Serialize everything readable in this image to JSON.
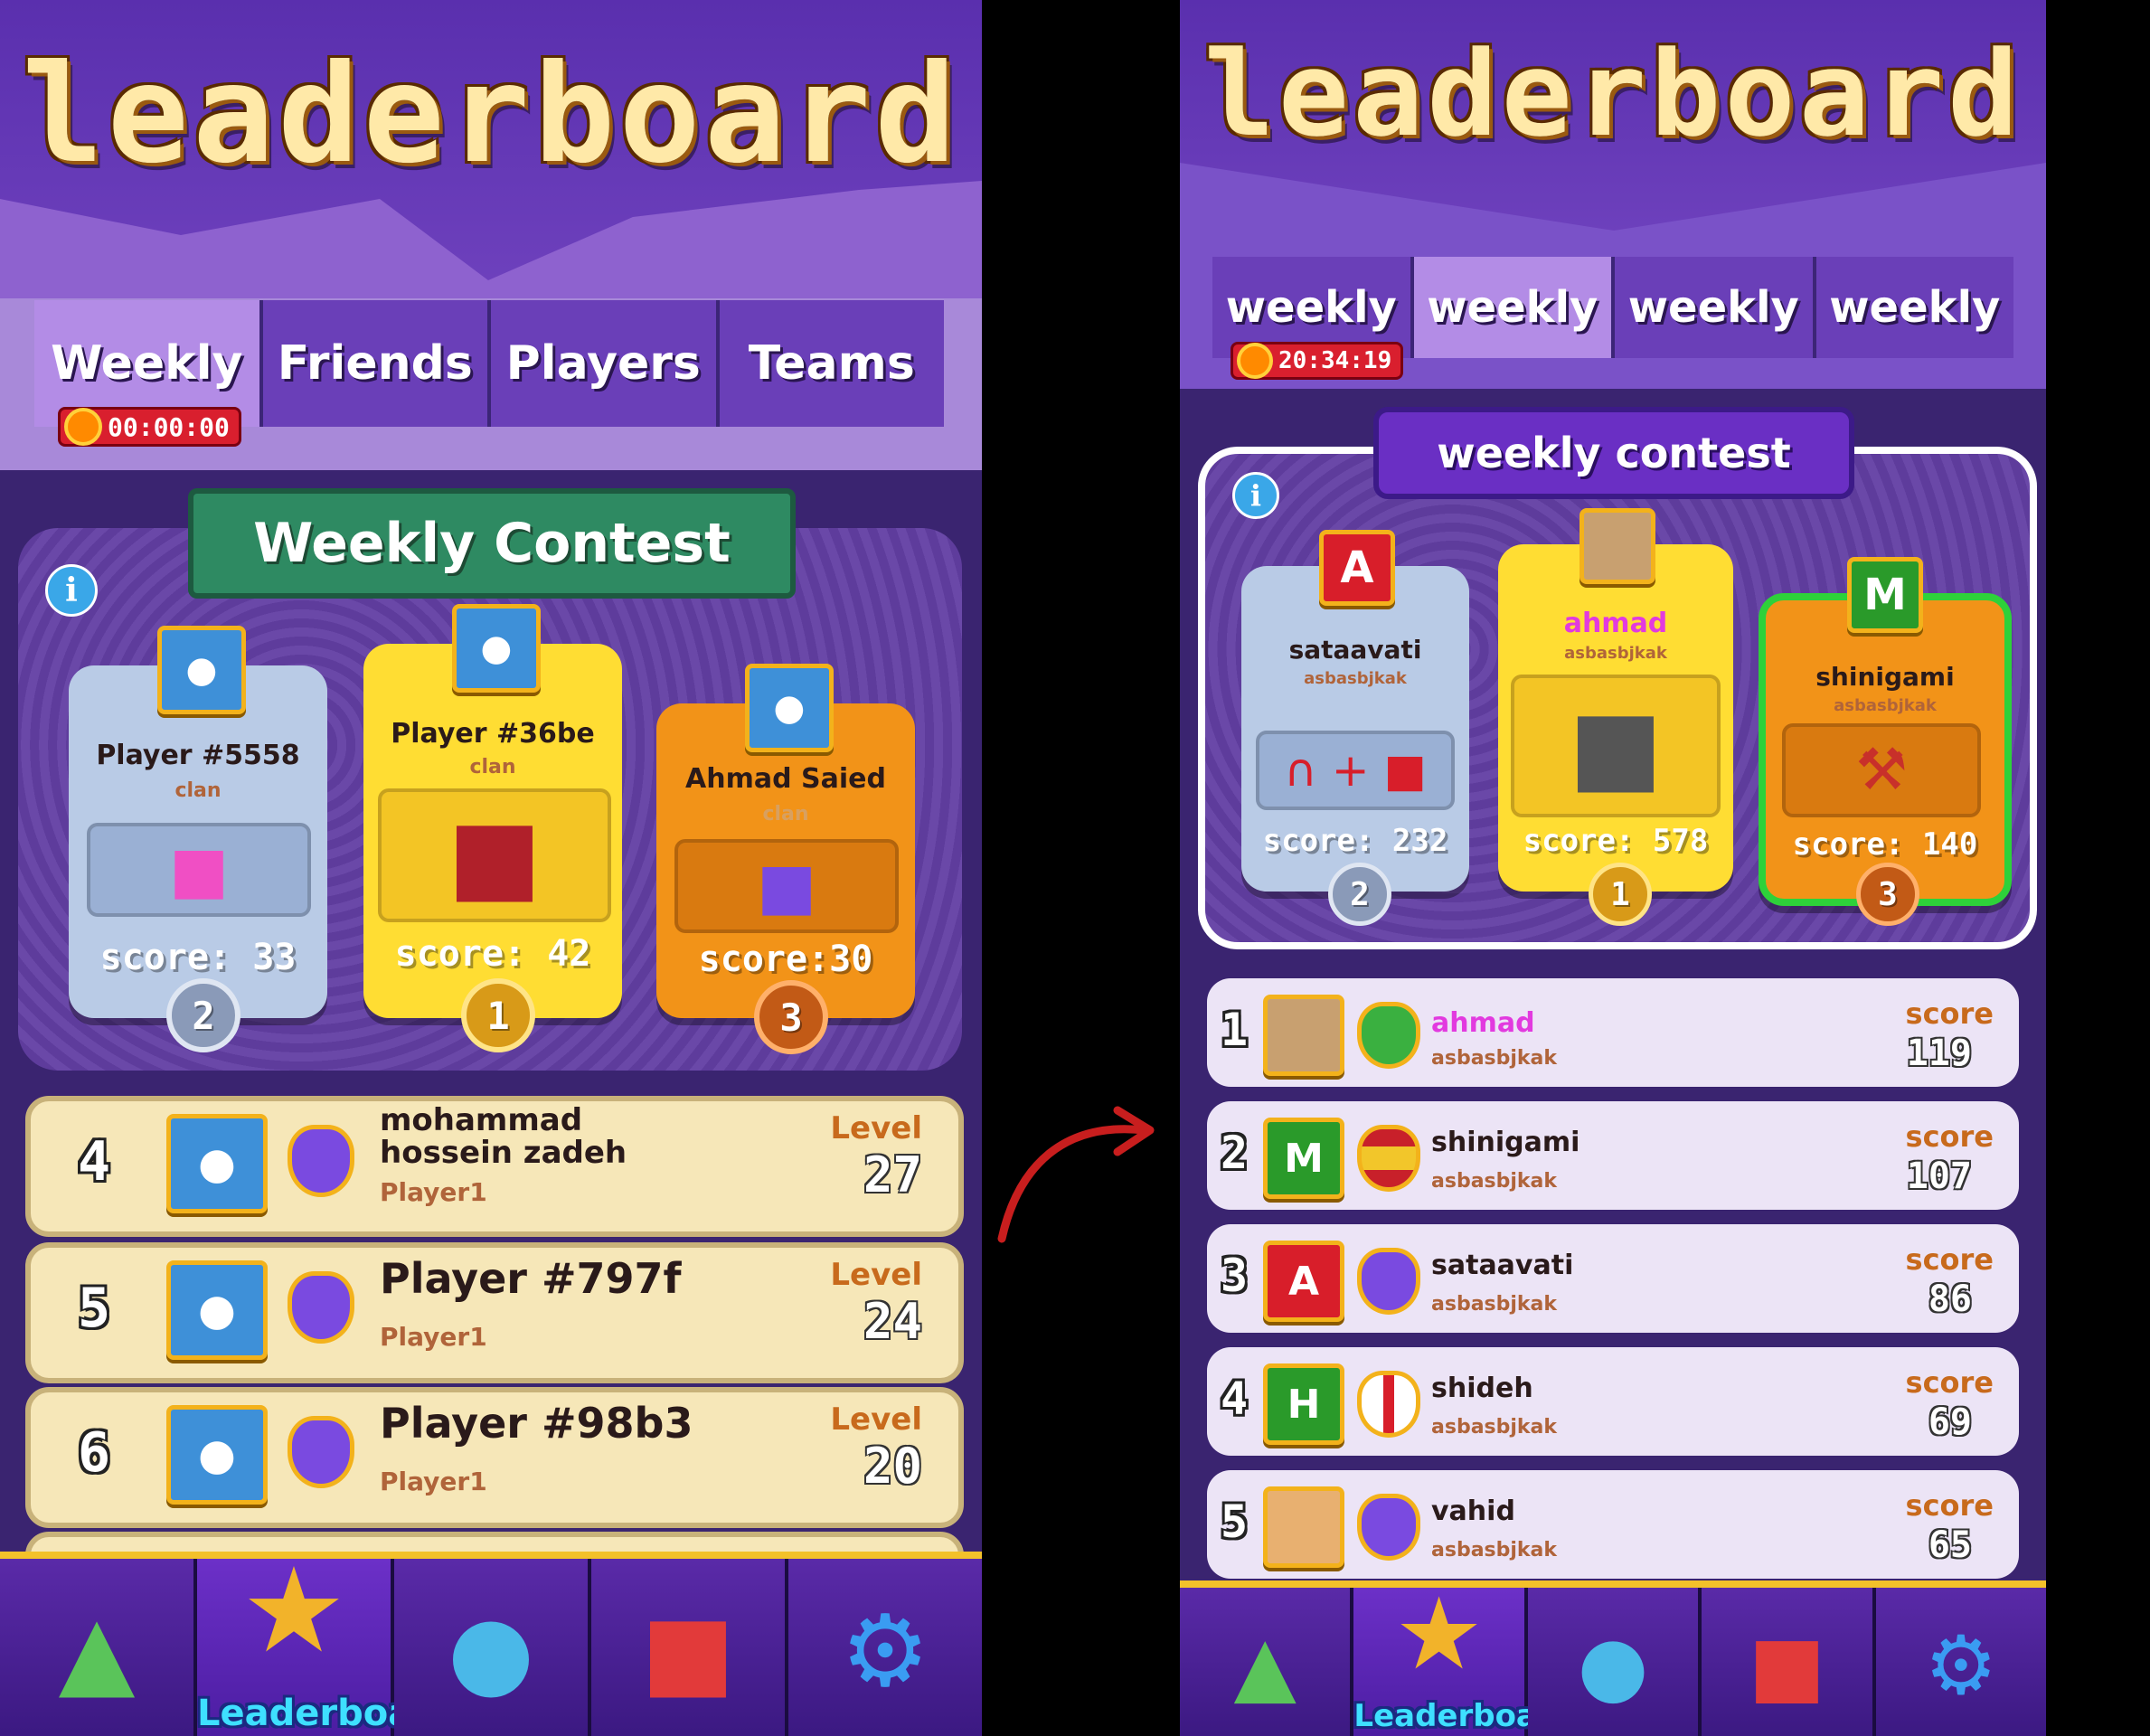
{
  "left": {
    "title": "leaderboard",
    "tabs": [
      {
        "label": "Weekly",
        "active": true
      },
      {
        "label": "Friends",
        "active": false
      },
      {
        "label": "Players",
        "active": false
      },
      {
        "label": "Teams",
        "active": false
      }
    ],
    "timer": "00:00:00",
    "contest_title": "Weekly Contest",
    "podium": [
      {
        "name": "Player #5558",
        "sub": "clan",
        "score": "score: 33",
        "rank": "2",
        "reward_icon": "pink-gift-icon",
        "color": "#b9cbe6"
      },
      {
        "name": "Player #36be",
        "sub": "clan",
        "score": "score: 42",
        "rank": "1",
        "reward_icon": "treasure-chest-icon",
        "color": "#ffdd33"
      },
      {
        "name": "Ahmad Saied",
        "sub": "clan",
        "score": "score:30",
        "rank": "3",
        "reward_icon": "purple-gift-icon",
        "color": "#f29318"
      }
    ],
    "rows": [
      {
        "rank": "4",
        "name": "mohammad hossein zadeh",
        "sub": "Player1",
        "score_label": "Level",
        "score": "27"
      },
      {
        "rank": "5",
        "name": "Player #797f",
        "sub": "Player1",
        "score_label": "Level",
        "score": "24"
      },
      {
        "rank": "6",
        "name": "Player #98b3",
        "sub": "Player1",
        "score_label": "Level",
        "score": "20"
      }
    ],
    "nav": [
      {
        "icon": "map-pin-icon"
      },
      {
        "icon": "trophy-icon",
        "label": "Leaderboard",
        "active": true
      },
      {
        "icon": "globe-icon"
      },
      {
        "icon": "backpack-icon"
      },
      {
        "icon": "gear-icon"
      }
    ]
  },
  "right": {
    "title": "leaderboard",
    "tabs": [
      {
        "label": "weekly",
        "active": false
      },
      {
        "label": "weekly",
        "active": true
      },
      {
        "label": "weekly",
        "active": false
      },
      {
        "label": "weekly",
        "active": false
      }
    ],
    "timer": "20:34:19",
    "contest_title": "weekly contest",
    "podium": [
      {
        "avatar": "A",
        "name": "sataavati",
        "sub": "asbasbjkak",
        "score": "score: 232",
        "rank": "2",
        "reward_icon": "magnet-plus-tnt-icon",
        "color": "#b9cbe6"
      },
      {
        "avatar": "",
        "name": "ahmad",
        "sub": "asbasbjkak",
        "score": "score: 578",
        "rank": "1",
        "reward_icon": "crate-icon",
        "color": "#ffdd33"
      },
      {
        "avatar": "M",
        "name": "shinigami",
        "sub": "asbasbjkak",
        "score": "score: 140",
        "rank": "3",
        "reward_icon": "hammer-icon",
        "color": "#f29318"
      }
    ],
    "rows": [
      {
        "rank": "1",
        "avatar": "",
        "name": "ahmad",
        "sub": "asbasbjkak",
        "score_label": "score",
        "score": "119",
        "badge": "clover-icon",
        "name_color": "#e23adf"
      },
      {
        "rank": "2",
        "avatar": "M",
        "name": "shinigami",
        "sub": "asbasbjkak",
        "score_label": "score",
        "score": "107",
        "badge": "spain-flag-icon",
        "name_color": "#2a1a1a"
      },
      {
        "rank": "3",
        "avatar": "A",
        "name": "sataavati",
        "sub": "asbasbjkak",
        "score_label": "score",
        "score": "86",
        "badge": "chef-hat-icon",
        "name_color": "#2a1a1a"
      },
      {
        "rank": "4",
        "avatar": "H",
        "name": "shideh",
        "sub": "asbasbjkak",
        "score_label": "score",
        "score": "69",
        "badge": "england-flag-icon",
        "name_color": "#2a1a1a"
      },
      {
        "rank": "5",
        "avatar": "",
        "name": "vahid",
        "sub": "asbasbjkak",
        "score_label": "score",
        "score": "65",
        "badge": "chef-hat-icon",
        "name_color": "#2a1a1a"
      }
    ],
    "nav": [
      {
        "icon": "map-pin-icon"
      },
      {
        "icon": "trophy-icon",
        "label": "Leaderboard",
        "active": true
      },
      {
        "icon": "globe-icon"
      },
      {
        "icon": "backpack-icon"
      },
      {
        "icon": "gear-icon"
      }
    ]
  }
}
